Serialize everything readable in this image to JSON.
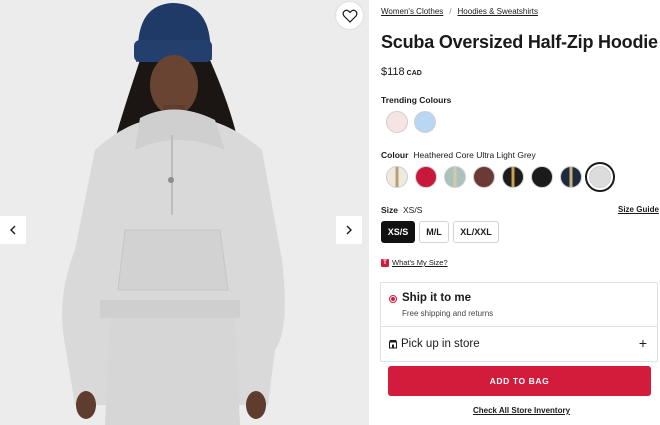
{
  "breadcrumb": [
    "Women's Clothes",
    "Hoodies & Sweatshirts"
  ],
  "breadcrumb_separator": "/",
  "product": {
    "title": "Scuba Oversized Half-Zip Hoodie",
    "price": "$118",
    "currency": "CAD"
  },
  "trending": {
    "label": "Trending Colours",
    "swatches": [
      {
        "icon": "pale-pink-swatch",
        "color": "#f6e4e4"
      },
      {
        "icon": "light-blue-swatch",
        "color": "#b9d6f2"
      }
    ]
  },
  "colour": {
    "label": "Colour",
    "selected_name": "Heathered Core Ultra Light Grey",
    "swatches": [
      {
        "icon": "cream-stripe-swatch",
        "color": "#efe8dc",
        "stripe": "#b8a27a"
      },
      {
        "icon": "red-swatch",
        "color": "#c8193a"
      },
      {
        "icon": "sage-stripe-swatch",
        "color": "#a9c2bd",
        "stripe": "#d6c9a6"
      },
      {
        "icon": "brown-swatch",
        "color": "#6b3a34"
      },
      {
        "icon": "black-gold-swatch",
        "color": "#1c1c1c",
        "stripe": "#c9a24a"
      },
      {
        "icon": "black-swatch",
        "color": "#1b1b1b"
      },
      {
        "icon": "navy-stripe-swatch",
        "color": "#1f2a3f",
        "stripe": "#c7b47e"
      },
      {
        "icon": "light-grey-swatch",
        "color": "#dcdcdc"
      }
    ]
  },
  "size": {
    "label": "Size",
    "selected": "XS/S",
    "options": [
      "XS/S",
      "M/L",
      "XL/XXL"
    ],
    "guide_label": "Size Guide",
    "whats_my_size": "What's My Size?",
    "whats_my_size_icon": "T"
  },
  "delivery": {
    "ship_title": "Ship it to me",
    "ship_subtitle": "Free shipping and returns",
    "pickup_title": "Pick up in store",
    "plus": "+"
  },
  "actions": {
    "add_to_bag": "ADD TO BAG",
    "check_inventory": "Check All Store Inventory"
  },
  "colors": {
    "accent": "#d31c3b",
    "text": "#1a1a1a",
    "gallery_bg": "#ececec"
  }
}
